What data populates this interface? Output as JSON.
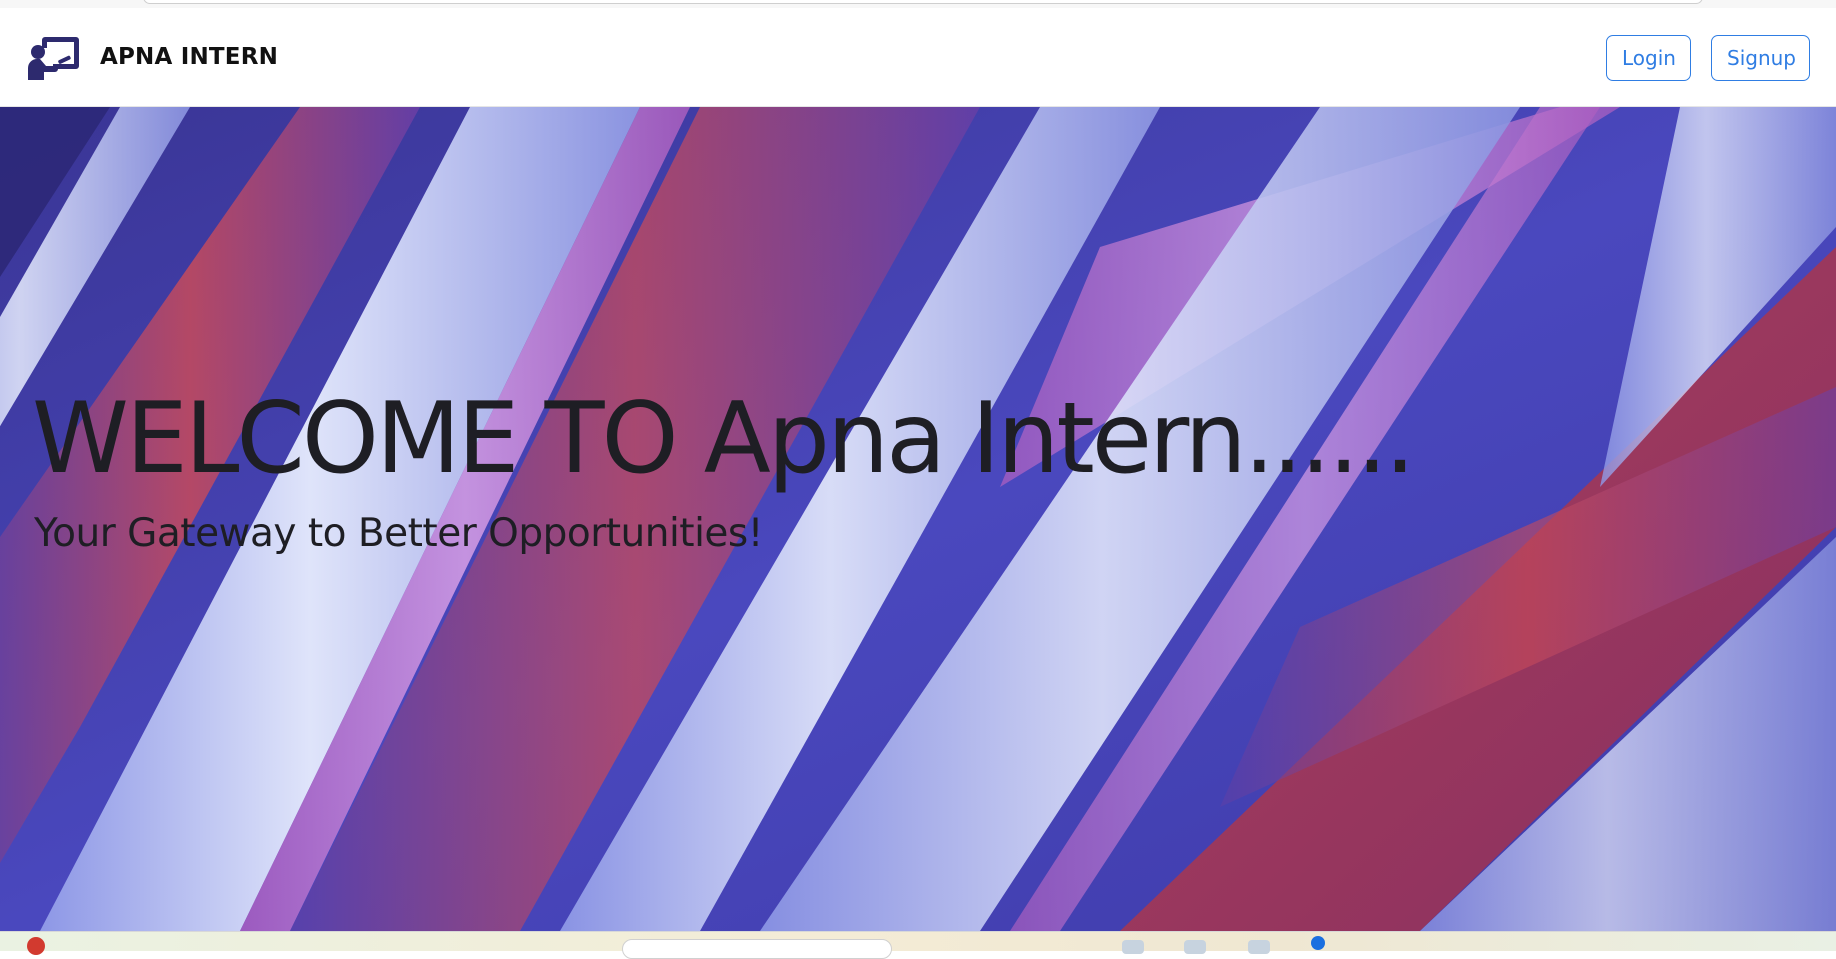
{
  "navbar": {
    "brand_name": "APNA INTERN",
    "brand_icon": "teacher-presentation-icon",
    "login_label": "Login",
    "signup_label": "Signup"
  },
  "hero": {
    "title": "WELCOME TO Apna Intern......",
    "subtitle": "Your Gateway to Better Opportunities!"
  },
  "colors": {
    "brand_icon": "#2d2a6e",
    "button_accent": "#2f7de3",
    "hero_text": "#1e1e24"
  }
}
